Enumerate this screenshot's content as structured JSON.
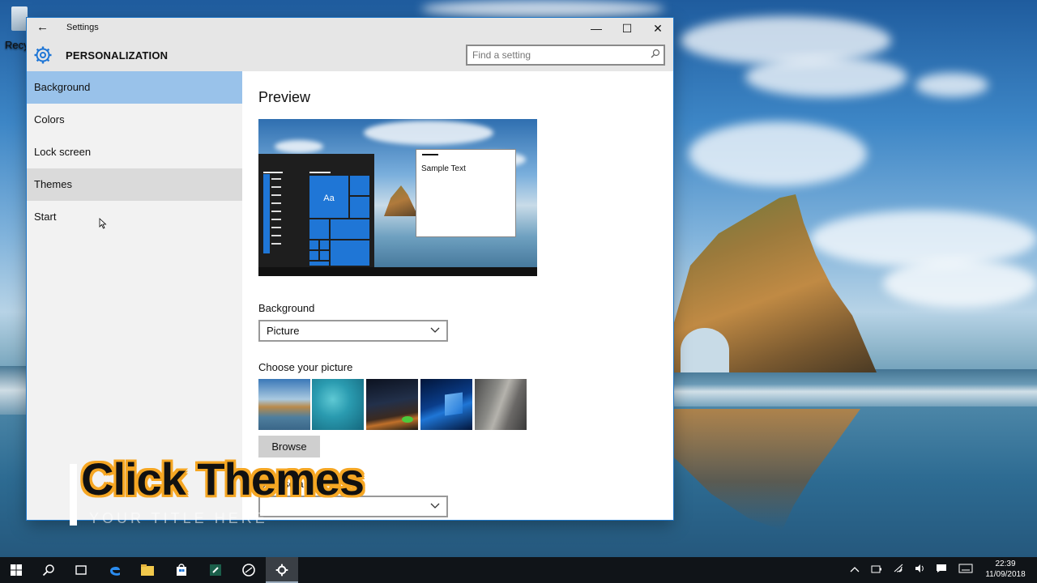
{
  "desktop": {
    "recycle_label": "Recyc"
  },
  "window": {
    "app_title": "Settings",
    "back_icon": "←",
    "minimize_icon": "—",
    "maximize_icon": "☐",
    "close_icon": "✕",
    "page_title": "PERSONALIZATION",
    "search_placeholder": "Find a setting"
  },
  "sidebar": {
    "items": [
      {
        "label": "Background",
        "state": "selected"
      },
      {
        "label": "Colors",
        "state": "normal"
      },
      {
        "label": "Lock screen",
        "state": "normal"
      },
      {
        "label": "Themes",
        "state": "hover"
      },
      {
        "label": "Start",
        "state": "normal"
      }
    ]
  },
  "main": {
    "preview_heading": "Preview",
    "preview_tile_label": "Aa",
    "sample_text": "Sample Text",
    "background_label": "Background",
    "background_value": "Picture",
    "choose_picture_label": "Choose your picture",
    "browse_label": "Browse",
    "choose_fit_label": "Choose a fit"
  },
  "overlay": {
    "caption": "Click Themes",
    "subcaption": "YOUR TITLE HERE"
  },
  "taskbar": {
    "start_icon": "windows-logo-icon",
    "clock_time": "22:39",
    "clock_date": "11/09/2018"
  },
  "colors": {
    "accent": "#1f76d6",
    "nav_selected": "#99c2ea",
    "caption_outline": "#f5a623"
  }
}
